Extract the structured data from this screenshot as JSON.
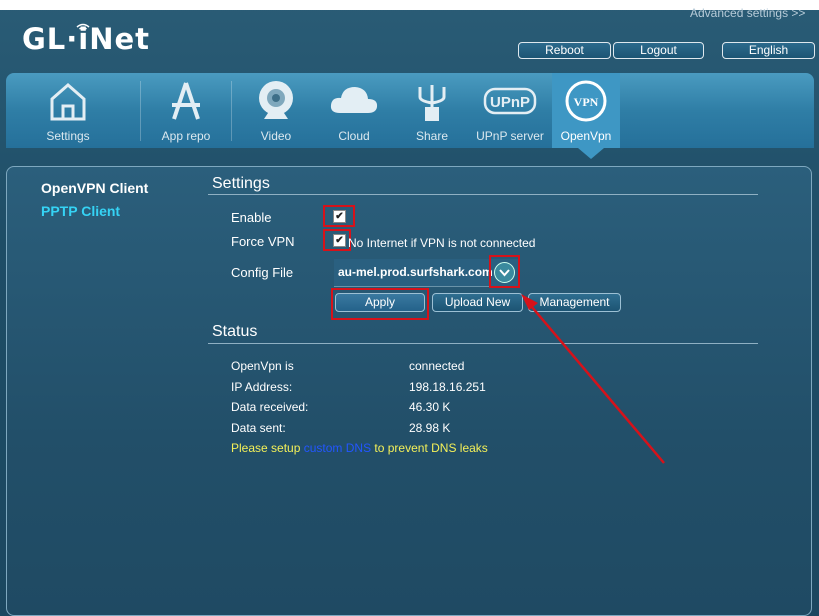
{
  "header": {
    "advanced_link": "Advanced settings >>",
    "logo": "GL·iNet",
    "reboot": "Reboot",
    "logout": "Logout",
    "language": "English"
  },
  "nav": {
    "items": [
      {
        "label": "Settings",
        "icon": "home-icon"
      },
      {
        "label": "App repo",
        "icon": "app-store-icon"
      },
      {
        "label": "Video",
        "icon": "webcam-icon"
      },
      {
        "label": "Cloud",
        "icon": "cloud-icon"
      },
      {
        "label": "Share",
        "icon": "usb-icon"
      },
      {
        "label": "UPnP server",
        "icon": "upnp-icon"
      },
      {
        "label": "OpenVpn",
        "icon": "vpn-icon",
        "active": true
      }
    ],
    "upnp_badge": "UPnP",
    "vpn_badge": "VPN"
  },
  "sidebar": {
    "items": [
      {
        "label": "OpenVPN Client",
        "color": "#ffffff"
      },
      {
        "label": "PPTP Client",
        "color": "#35d3f5"
      }
    ]
  },
  "settings": {
    "title": "Settings",
    "enable_label": "Enable",
    "enable_checked": true,
    "force_label": "Force VPN",
    "force_checked": true,
    "force_note": "No Internet if VPN is not connected",
    "config_label": "Config File",
    "config_value": "au-mel.prod.surfshark.com",
    "apply": "Apply",
    "upload": "Upload New",
    "management": "Management"
  },
  "status": {
    "title": "Status",
    "rows": [
      {
        "key": "OpenVpn is",
        "value": "connected"
      },
      {
        "key": "IP Address:",
        "value": "198.18.16.251"
      },
      {
        "key": "Data received:",
        "value": "46.30 K"
      },
      {
        "key": "Data sent:",
        "value": "28.98 K"
      }
    ],
    "warning_pre": "Please setup ",
    "warning_link": "custom DNS",
    "warning_post": " to prevent DNS leaks"
  },
  "colors": {
    "annotation": "#d6121a",
    "warning": "#f4f058",
    "link": "#2356ff"
  }
}
